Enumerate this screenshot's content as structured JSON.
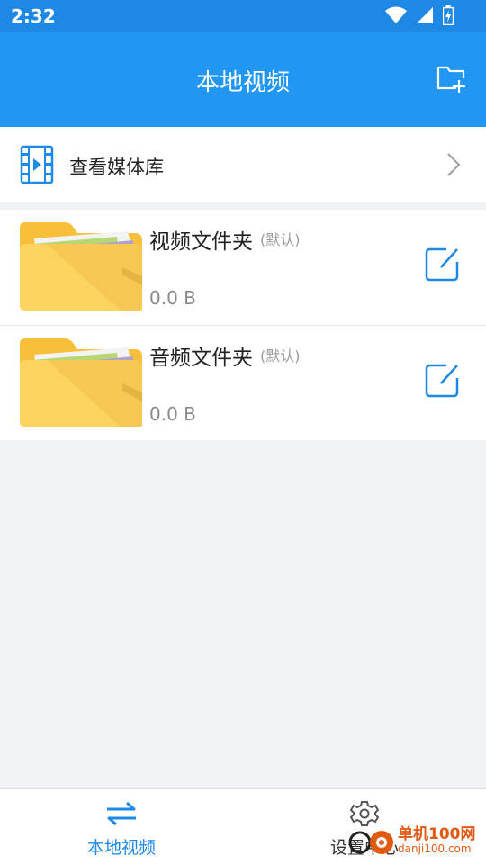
{
  "status_bar": {
    "time": "2:32"
  },
  "app_bar": {
    "title": "本地视频"
  },
  "media_library": {
    "label": "查看媒体库"
  },
  "folders": [
    {
      "name": "视频文件夹",
      "default_tag": "(默认)",
      "size": "0.0 B"
    },
    {
      "name": "音频文件夹",
      "default_tag": "(默认)",
      "size": "0.0 B"
    }
  ],
  "bottom_nav": [
    {
      "label": "本地视频",
      "icon": "swap-arrows-icon",
      "active": true
    },
    {
      "label": "设置中心",
      "icon": "gear-icon",
      "active": false
    }
  ],
  "watermark": {
    "line1": "单机100网",
    "line2": "danji100.com"
  },
  "colors": {
    "primary": "#2196f3",
    "status_bar": "#1e88e5",
    "folder": "#fdd35f",
    "background": "#f2f3f7"
  }
}
